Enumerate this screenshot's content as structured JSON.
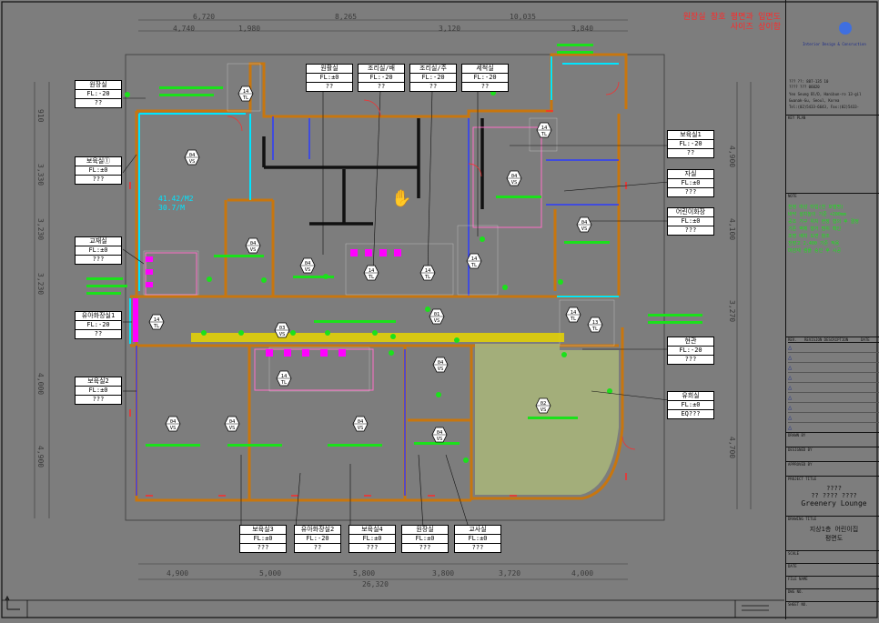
{
  "warning": [
    "원장실 창호 평면과 입면도",
    "사이즈 상이함"
  ],
  "top_dims_row1": [
    "6,720",
    "8,265",
    "10,035"
  ],
  "top_dims_row2": [
    "4,740",
    "1,980",
    "3,120",
    "3,840"
  ],
  "bottom_dims_row1": [
    "4,900",
    "5,000",
    "5,800",
    "3,800",
    "3,720",
    "4,000"
  ],
  "bottom_total": "26,320",
  "left_dims": [
    "910",
    "3,330",
    "3,230",
    "3,230",
    "4,000",
    "4,900"
  ],
  "right_dims": [
    "4,900",
    "4,100",
    "3,270",
    "4,700"
  ],
  "area_note": [
    "41.42/M2",
    "30.7/M"
  ],
  "room_tags": [
    {
      "name": "원장실",
      "fl": "FL:-20",
      "note": "??"
    },
    {
      "name": "보육실①",
      "fl": "FL:±0",
      "note": "???"
    },
    {
      "name": "교재실",
      "fl": "FL:±0",
      "note": "???"
    },
    {
      "name": "유아화장실1",
      "fl": "FL:-20",
      "note": "??"
    },
    {
      "name": "보육실2",
      "fl": "FL:±0",
      "note": "???"
    },
    {
      "name": "원활실",
      "fl": "FL:±0",
      "note": "??"
    },
    {
      "name": "조리실/배",
      "fl": "FL:-20",
      "note": "??"
    },
    {
      "name": "조리실/주",
      "fl": "FL:-20",
      "note": "??"
    },
    {
      "name": "세척실",
      "fl": "FL:-20",
      "note": "??"
    },
    {
      "name": "보육실1",
      "fl": "FL:-20",
      "note": "??"
    },
    {
      "name": "자실",
      "fl": "FL:±0",
      "note": "???"
    },
    {
      "name": "어린이화장",
      "fl": "FL:±0",
      "note": "???"
    },
    {
      "name": "현관",
      "fl": "FL:-20",
      "note": "???"
    },
    {
      "name": "유희실",
      "fl": "FL:±0",
      "note": "EQ???"
    },
    {
      "name": "보육실3",
      "fl": "FL:±0",
      "note": "???"
    },
    {
      "name": "유아화장실2",
      "fl": "FL:-20",
      "note": "??"
    },
    {
      "name": "보육실4",
      "fl": "FL:±0",
      "note": "???"
    },
    {
      "name": "원장실",
      "fl": "FL:±0",
      "note": "???"
    },
    {
      "name": "교사실",
      "fl": "FL:±0",
      "note": "???"
    }
  ],
  "finish_codes": [
    "04 VS",
    "04 VS",
    "04 VS",
    "04 VS",
    "04 VS",
    "04 VS",
    "04 VS",
    "04 VS",
    "04 VS",
    "04 VS",
    "02 VS",
    "01 VS",
    "03 VS",
    "14 TL",
    "14 TL",
    "14 TL",
    "14 TL",
    "14 TL",
    "14 TL",
    "14 TL",
    "14 TL",
    "13 TL"
  ],
  "title_block": {
    "company": "Interior Design & Consruction",
    "contact": [
      "??? ??: 887-135 10",
      "???? ??? 06020",
      "Yeo Seung Bl/D, Hanibun-ro 13-gil",
      "Gwanak-Gu, Seoul, Korea",
      "Tel:(02)5433-6643, Fax:(02)5433-"
    ],
    "key_plan": "KEY PLAN",
    "note": "NOTE",
    "note_lines": [
      "천정 마감 타입(천 모델명)",
      "바닥 설치높이 기준 +200mm",
      "공조 기구 위치 현장 협의 후 결정",
      "기존 벽체 철거 범위 확인",
      "조명 배치 도면 참조",
      "천장고 2,400 기준 적용",
      "마감재 샘플 승인 후 시공"
    ],
    "rev_headers": [
      "REV.",
      "REVISION DESCRIPTION",
      "DATE"
    ],
    "drawn_by": "DRAWN BY",
    "designed_by": "DESIGNED BY",
    "approved_by": "APPROVED BY",
    "project_title": "PROJECT TITLE",
    "project_lines": [
      "????",
      "?? ???? ????"
    ],
    "project_name": "Greenery Lounge",
    "drawing_title": "DRAWING TITLE",
    "drawing_name": [
      "지상1층 어린이집",
      "평면도"
    ],
    "scale": "SCALE",
    "date": "DATE",
    "file_name": "FILE NAME",
    "dwg_no": "DWG NO.",
    "sheet_no": "SHEET NO."
  },
  "colors": {
    "background": "#7d7d7d",
    "wall": "#c8760e",
    "glass": "#00e5ff",
    "text_green": "#1be11b",
    "magenta": "#ff00ff",
    "yellow": "#e6d500",
    "tag_bg": "#ffffff",
    "warning": "#ff2a2a"
  },
  "icons": [
    "pan-hand-cursor-icon",
    "ucs-icon",
    "logo-circle-icon"
  ]
}
